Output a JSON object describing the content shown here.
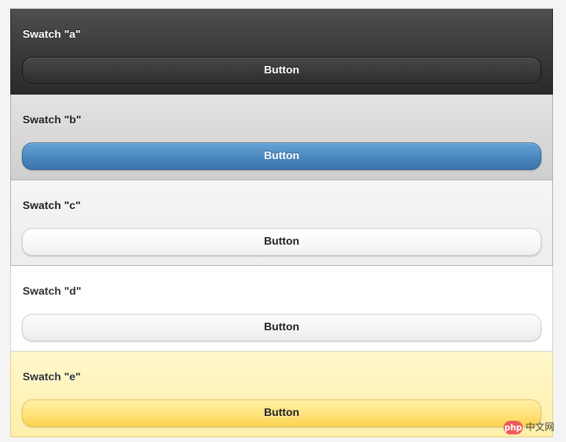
{
  "swatches": [
    {
      "title": "Swatch \"a\"",
      "button_label": "Button"
    },
    {
      "title": "Swatch \"b\"",
      "button_label": "Button"
    },
    {
      "title": "Swatch \"c\"",
      "button_label": "Button"
    },
    {
      "title": "Swatch \"d\"",
      "button_label": "Button"
    },
    {
      "title": "Swatch \"e\"",
      "button_label": "Button"
    }
  ],
  "watermark": {
    "logo_text": "php",
    "site_text": "中文网"
  },
  "colors": {
    "swatch_a": "#2f2f2f",
    "swatch_b": "#d4d4d4",
    "swatch_c": "#f1f1f1",
    "swatch_d": "#ffffff",
    "swatch_e": "#fff2b8",
    "button_b": "#4a86c0",
    "button_e": "#fddf73"
  }
}
